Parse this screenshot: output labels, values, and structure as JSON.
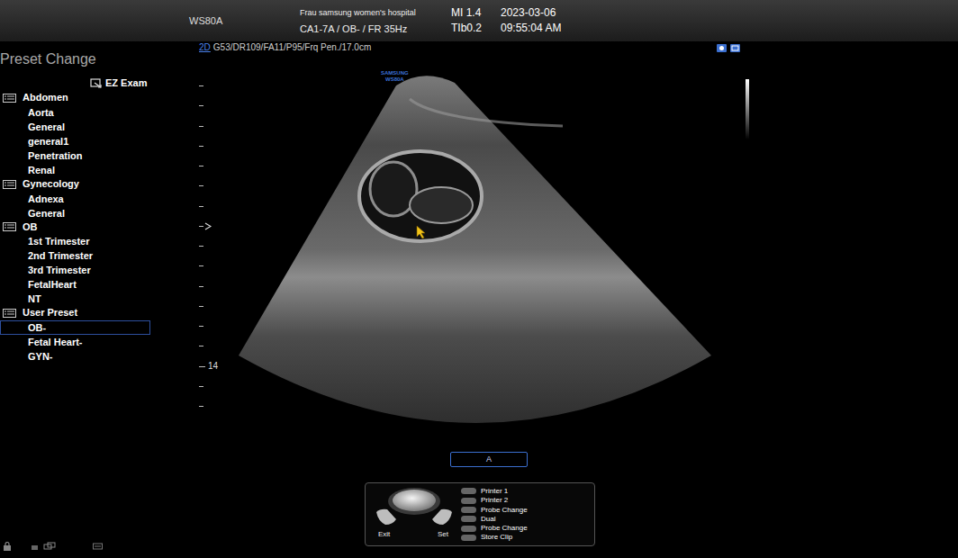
{
  "topbar": {
    "model": "WS80A",
    "hospital": "Frau samsung women's hospital",
    "probe_line": "CA1-7A / OB- / FR 35Hz",
    "mi": "MI 1.4",
    "tib": "TIb0.2",
    "date": "2023-03-06",
    "time": "09:55:04 AM"
  },
  "image_header": {
    "mode": "2D",
    "params": "G53/DR109/FA11/P95/Frq Pen./17.0cm"
  },
  "preset_panel": {
    "title": "Preset Change",
    "ez_exam": "EZ Exam",
    "groups": [
      {
        "label": "Abdomen",
        "items": [
          {
            "label": "Aorta",
            "selected": false
          },
          {
            "label": "General",
            "selected": false
          },
          {
            "label": "general1",
            "selected": false
          },
          {
            "label": "Penetration",
            "selected": false
          },
          {
            "label": "Renal",
            "selected": false
          }
        ]
      },
      {
        "label": "Gynecology",
        "items": [
          {
            "label": "Adnexa",
            "selected": false
          },
          {
            "label": "General",
            "selected": false
          }
        ]
      },
      {
        "label": "OB",
        "items": [
          {
            "label": "1st Trimester",
            "selected": false
          },
          {
            "label": "2nd Trimester",
            "selected": false
          },
          {
            "label": "3rd Trimester",
            "selected": false
          },
          {
            "label": "FetalHeart",
            "selected": false
          },
          {
            "label": "NT",
            "selected": false
          }
        ]
      },
      {
        "label": "User Preset",
        "items": [
          {
            "label": "OB-",
            "selected": true
          },
          {
            "label": "Fetal Heart-",
            "selected": false
          },
          {
            "label": "GYN-",
            "selected": false
          }
        ]
      }
    ]
  },
  "image": {
    "logo_line1": "SAMSUNG",
    "logo_line2": "WS80A",
    "depth_label": "14"
  },
  "body_marker": "A",
  "trackball": {
    "left": "Exit",
    "right": "Set",
    "keys": [
      "Printer 1",
      "Printer 2",
      "Probe Change",
      "Dual",
      "Probe Change",
      "Store Clip"
    ]
  }
}
